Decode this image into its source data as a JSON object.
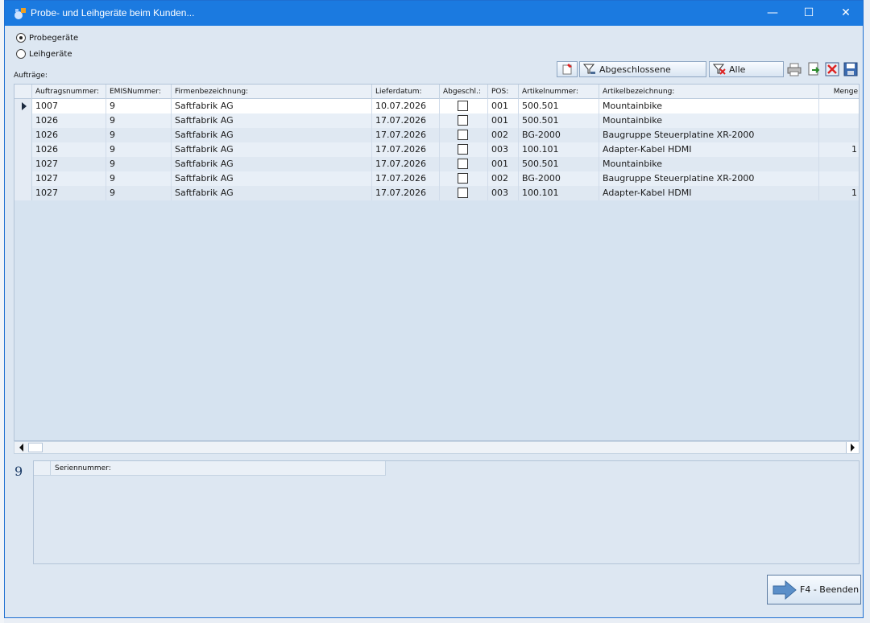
{
  "window": {
    "title": "Probe- und Leihgeräte beim Kunden...",
    "controls": {
      "minimize": "—",
      "maximize": "☐",
      "close": "✕"
    }
  },
  "options": [
    {
      "label": "Probegeräte",
      "checked": true
    },
    {
      "label": "Leihgeräte",
      "checked": false
    }
  ],
  "orders_label": "Aufträge:",
  "toolbar": {
    "closed_label": "Abgeschlossene",
    "all_label": "Alle"
  },
  "grid": {
    "columns": [
      "Auftragsnummer:",
      "EMISNummer:",
      "Firmenbezeichnung:",
      "Lieferdatum:",
      "Abgeschl.:",
      "POS:",
      "Artikelnummer:",
      "Artikelbezeichnung:",
      "Menge"
    ],
    "rows": [
      [
        "1007",
        "9",
        "Saftfabrik AG",
        "10.07.2026",
        false,
        "001",
        "500.501",
        "Mountainbike",
        ""
      ],
      [
        "1026",
        "9",
        "Saftfabrik AG",
        "17.07.2026",
        false,
        "001",
        "500.501",
        "Mountainbike",
        ""
      ],
      [
        "1026",
        "9",
        "Saftfabrik AG",
        "17.07.2026",
        false,
        "002",
        "BG-2000",
        "Baugruppe Steuerplatine XR-2000",
        ""
      ],
      [
        "1026",
        "9",
        "Saftfabrik AG",
        "17.07.2026",
        false,
        "003",
        "100.101",
        "Adapter-Kabel HDMI",
        "1"
      ],
      [
        "1027",
        "9",
        "Saftfabrik AG",
        "17.07.2026",
        false,
        "001",
        "500.501",
        "Mountainbike",
        ""
      ],
      [
        "1027",
        "9",
        "Saftfabrik AG",
        "17.07.2026",
        false,
        "002",
        "BG-2000",
        "Baugruppe Steuerplatine XR-2000",
        ""
      ],
      [
        "1027",
        "9",
        "Saftfabrik AG",
        "17.07.2026",
        false,
        "003",
        "100.101",
        "Adapter-Kabel HDMI",
        "1"
      ]
    ]
  },
  "detail": {
    "emis_number": "9",
    "column": "Seriennummer:"
  },
  "quit_button": "F4 - Beenden",
  "colors": {
    "titlebar": "#1b7ae0",
    "window_bg": "#dde7f2",
    "selected_row": "#ffffff",
    "alt_row": "#e8eff7"
  }
}
